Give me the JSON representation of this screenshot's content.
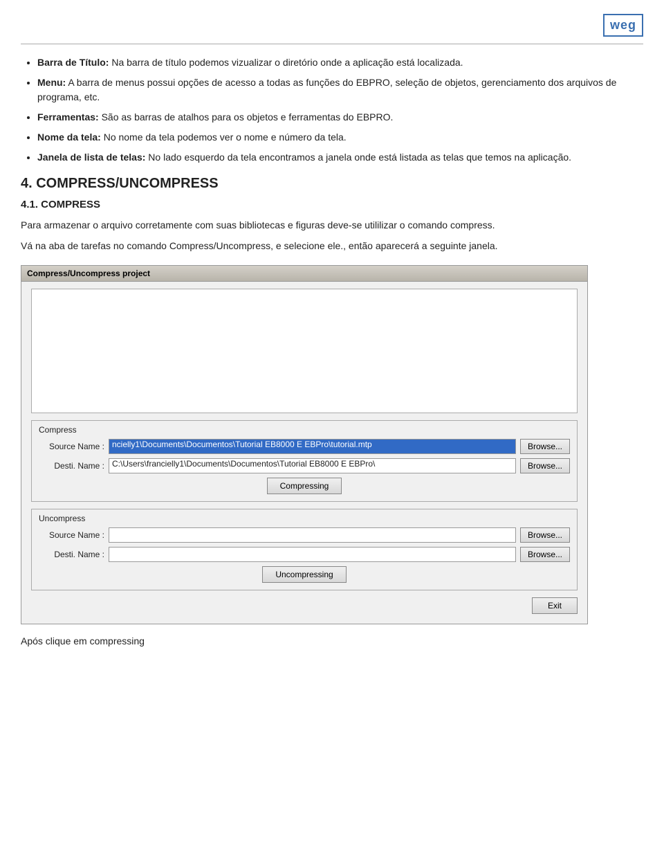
{
  "logo": {
    "text": "weg"
  },
  "bullets": [
    {
      "label": "Barra de Título:",
      "text": " Na barra de título podemos vizualizar o diretório onde a aplicação está localizada."
    },
    {
      "label": "Menu:",
      "text": " A barra de menus possui opções de acesso a todas as funções do EBPRO, seleção de objetos, gerenciamento dos arquivos de programa, etc."
    },
    {
      "label": "Ferramentas:",
      "text": " São as barras de atalhos para os objetos e ferramentas do EBPRO."
    },
    {
      "label": "Nome da tela:",
      "text": " No nome da tela podemos ver o nome e número da tela."
    },
    {
      "label": "Janela de lista de telas:",
      "text": " No lado esquerdo da tela encontramos a janela onde está listada as telas que temos na aplicação."
    }
  ],
  "section4": {
    "title": "4. COMPRESS/UNCOMPRESS",
    "sub_title": "4.1. COMPRESS",
    "body1": "Para armazenar o arquivo corretamente com suas bibliotecas e figuras deve-se utililizar o comando compress.",
    "body2": "Vá na aba de tarefas no comando Compress/Uncompress, e selecione ele., então aparecerá a seguinte janela."
  },
  "dialog": {
    "title": "Compress/Uncompress project",
    "compress_label": "Compress",
    "source_name_label": "Source Name :",
    "source_name_value": "ncielly1\\Documents\\Documentos\\Tutorial EB8000 E EBPro\\tutorial.mtp",
    "desti_name_label": "Desti. Name :",
    "desti_name_value": "C:\\Users\\francielly1\\Documents\\Documentos\\Tutorial EB8000 E EBPro\\",
    "compressing_btn": "Compressing",
    "browse_btn1": "Browse...",
    "browse_btn2": "Browse...",
    "uncompress_label": "Uncompress",
    "u_source_name_label": "Source Name :",
    "u_source_name_value": "",
    "u_desti_name_label": "Desti. Name :",
    "u_desti_name_value": "",
    "uncompressing_btn": "Uncompressing",
    "browse_btn3": "Browse...",
    "browse_btn4": "Browse...",
    "exit_btn": "Exit"
  },
  "caption": {
    "text": "Após clique em compressing"
  }
}
